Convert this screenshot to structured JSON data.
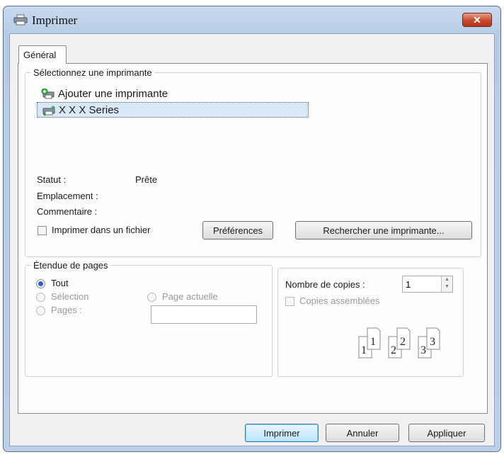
{
  "window": {
    "title": "Imprimer",
    "close_glyph": "✕"
  },
  "tabs": [
    {
      "label": "Général"
    }
  ],
  "printer_group": {
    "legend": "Sélectionnez une imprimante",
    "items": [
      {
        "label": "Ajouter une imprimante",
        "icon": "add-printer-icon"
      },
      {
        "label": "X X X Series",
        "icon": "printer-icon",
        "selected": true
      }
    ],
    "status_label": "Statut :",
    "status_value": "Prête",
    "location_label": "Emplacement :",
    "comment_label": "Commentaire :",
    "print_to_file_label": "Imprimer dans un fichier",
    "print_to_file_checked": false,
    "preferences_button": "Préférences",
    "find_printer_button": "Rechercher une imprimante..."
  },
  "range_group": {
    "legend": "Étendue de pages",
    "all_label": "Tout",
    "selection_label": "Sélection",
    "current_page_label": "Page actuelle",
    "pages_label": "Pages :",
    "pages_value": "",
    "selected": "all"
  },
  "copies_group": {
    "copies_label": "Nombre de copies :",
    "copies_value": "1",
    "collate_label": "Copies assemblées",
    "collate_checked": false,
    "collate_pages": [
      "1",
      "1",
      "2",
      "2",
      "3",
      "3"
    ]
  },
  "buttons": {
    "print": "Imprimer",
    "cancel": "Annuler",
    "apply": "Appliquer"
  },
  "colors": {
    "title_bar": "#c9d9ee",
    "close": "#c8482a",
    "default_button": "#bde6fd",
    "selection": "#d9e8fb"
  }
}
